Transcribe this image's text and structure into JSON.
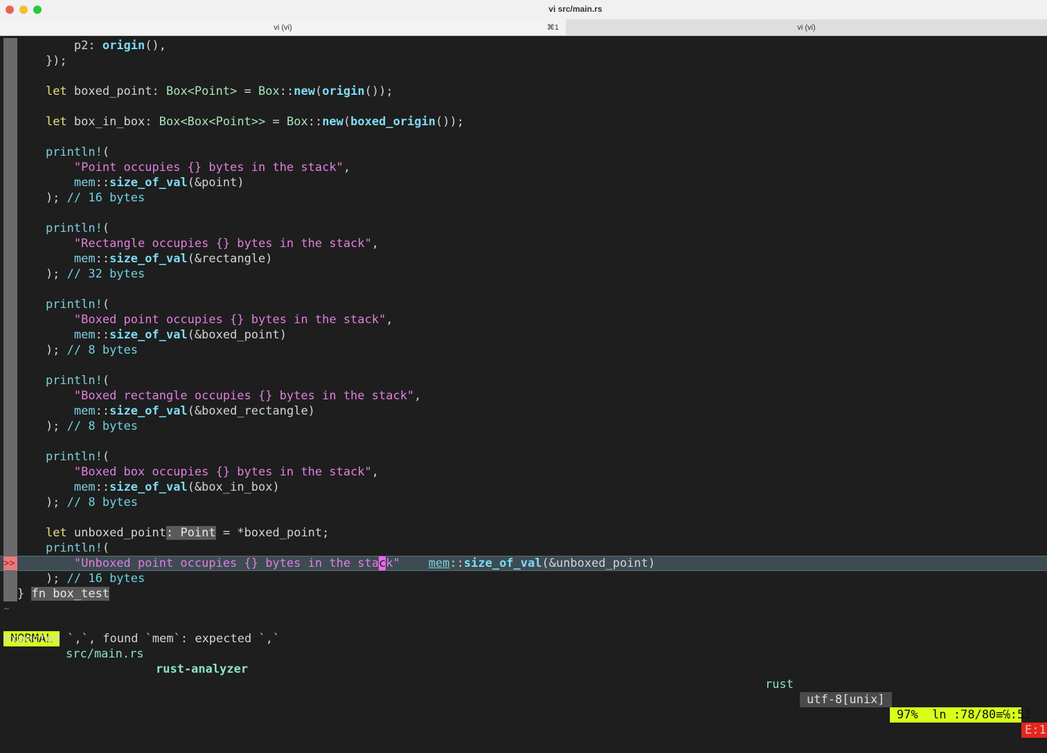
{
  "window": {
    "title": "vi src/main.rs",
    "traffic_colors": [
      "#ee5f57",
      "#f5bd30",
      "#29c840"
    ]
  },
  "tabs": [
    {
      "label": "vi (vi)",
      "shortcut": "⌘1",
      "active": true
    },
    {
      "label": "vi (vi)",
      "active": false
    }
  ],
  "code": [
    [
      [
        "        p2: ",
        ""
      ],
      [
        "origin",
        "fn"
      ],
      [
        "(),",
        ""
      ]
    ],
    [
      [
        "    });",
        ""
      ]
    ],
    [],
    [
      [
        "    ",
        ""
      ],
      [
        "let",
        "kw"
      ],
      [
        " boxed_point: ",
        ""
      ],
      [
        "Box<Point>",
        "ty"
      ],
      [
        " = ",
        ""
      ],
      [
        "Box",
        "ty"
      ],
      [
        "::",
        ""
      ],
      [
        "new",
        "fn"
      ],
      [
        "(",
        ""
      ],
      [
        "origin",
        "fn"
      ],
      [
        "());",
        ""
      ]
    ],
    [],
    [
      [
        "    ",
        ""
      ],
      [
        "let",
        "kw"
      ],
      [
        " box_in_box: ",
        ""
      ],
      [
        "Box<Box<Point>>",
        "ty"
      ],
      [
        " = ",
        ""
      ],
      [
        "Box",
        "ty"
      ],
      [
        "::",
        ""
      ],
      [
        "new",
        "fn"
      ],
      [
        "(",
        ""
      ],
      [
        "boxed_origin",
        "fn"
      ],
      [
        "());",
        ""
      ]
    ],
    [],
    [
      [
        "    ",
        ""
      ],
      [
        "println!",
        "mac"
      ],
      [
        "(",
        ""
      ]
    ],
    [
      [
        "        ",
        ""
      ],
      [
        "\"Point occupies {} bytes in the stack\"",
        "st"
      ],
      [
        ",",
        ""
      ]
    ],
    [
      [
        "        ",
        ""
      ],
      [
        "mem",
        "ns"
      ],
      [
        "::",
        ""
      ],
      [
        "size_of_val",
        "fn"
      ],
      [
        "(&point)",
        ""
      ]
    ],
    [
      [
        "    ); ",
        ""
      ],
      [
        "// 16 bytes",
        "cm"
      ]
    ],
    [],
    [
      [
        "    ",
        ""
      ],
      [
        "println!",
        "mac"
      ],
      [
        "(",
        ""
      ]
    ],
    [
      [
        "        ",
        ""
      ],
      [
        "\"Rectangle occupies {} bytes in the stack\"",
        "st"
      ],
      [
        ",",
        ""
      ]
    ],
    [
      [
        "        ",
        ""
      ],
      [
        "mem",
        "ns"
      ],
      [
        "::",
        ""
      ],
      [
        "size_of_val",
        "fn"
      ],
      [
        "(&rectangle)",
        ""
      ]
    ],
    [
      [
        "    ); ",
        ""
      ],
      [
        "// 32 bytes",
        "cm"
      ]
    ],
    [],
    [
      [
        "    ",
        ""
      ],
      [
        "println!",
        "mac"
      ],
      [
        "(",
        ""
      ]
    ],
    [
      [
        "        ",
        ""
      ],
      [
        "\"Boxed point occupies {} bytes in the stack\"",
        "st"
      ],
      [
        ",",
        ""
      ]
    ],
    [
      [
        "        ",
        ""
      ],
      [
        "mem",
        "ns"
      ],
      [
        "::",
        ""
      ],
      [
        "size_of_val",
        "fn"
      ],
      [
        "(&boxed_point)",
        ""
      ]
    ],
    [
      [
        "    ); ",
        ""
      ],
      [
        "// 8 bytes",
        "cm"
      ]
    ],
    [],
    [
      [
        "    ",
        ""
      ],
      [
        "println!",
        "mac"
      ],
      [
        "(",
        ""
      ]
    ],
    [
      [
        "        ",
        ""
      ],
      [
        "\"Boxed rectangle occupies {} bytes in the stack\"",
        "st"
      ],
      [
        ",",
        ""
      ]
    ],
    [
      [
        "        ",
        ""
      ],
      [
        "mem",
        "ns"
      ],
      [
        "::",
        ""
      ],
      [
        "size_of_val",
        "fn"
      ],
      [
        "(&boxed_rectangle)",
        ""
      ]
    ],
    [
      [
        "    ); ",
        ""
      ],
      [
        "// 8 bytes",
        "cm"
      ]
    ],
    [],
    [
      [
        "    ",
        ""
      ],
      [
        "println!",
        "mac"
      ],
      [
        "(",
        ""
      ]
    ],
    [
      [
        "        ",
        ""
      ],
      [
        "\"Boxed box occupies {} bytes in the stack\"",
        "st"
      ],
      [
        ",",
        ""
      ]
    ],
    [
      [
        "        ",
        ""
      ],
      [
        "mem",
        "ns"
      ],
      [
        "::",
        ""
      ],
      [
        "size_of_val",
        "fn"
      ],
      [
        "(&box_in_box)",
        ""
      ]
    ],
    [
      [
        "    ); ",
        ""
      ],
      [
        "// 8 bytes",
        "cm"
      ]
    ],
    [],
    [
      [
        "    ",
        ""
      ],
      [
        "let",
        "kw"
      ],
      [
        " unboxed_point",
        ""
      ],
      [
        ": Point",
        "hl"
      ],
      [
        " = *boxed_point;",
        ""
      ]
    ],
    [
      [
        "    ",
        ""
      ],
      [
        "println!",
        "mac"
      ],
      [
        "(",
        ""
      ]
    ],
    [
      [
        "        ",
        ""
      ],
      [
        "\"Unboxed point occupies {} bytes in the sta",
        "st"
      ],
      [
        "c",
        "cur"
      ],
      [
        "k\"",
        "st"
      ],
      [
        "    ",
        ""
      ],
      [
        "mem",
        "ul"
      ],
      [
        "::",
        ""
      ],
      [
        "size_of_val",
        "fn"
      ],
      [
        "(&unboxed_point)",
        ""
      ]
    ],
    [
      [
        "    ); ",
        ""
      ],
      [
        "// 16 bytes",
        "cm"
      ]
    ],
    [
      [
        "} ",
        ""
      ],
      [
        "fn box_test",
        "hl"
      ]
    ]
  ],
  "error_line_index": 34,
  "error_sign": ">>",
  "tilde": "~",
  "statusline": {
    "mode": "NORMAL",
    "file": "src/main.rs",
    "lsp": "rust-analyzer",
    "filetype": "rust",
    "encoding": "utf-8[unix]",
    "position": "97%  ln :78/80≡℅:52",
    "errors": "E:1"
  },
  "message": "expected `,`, found `mem`: expected `,`"
}
